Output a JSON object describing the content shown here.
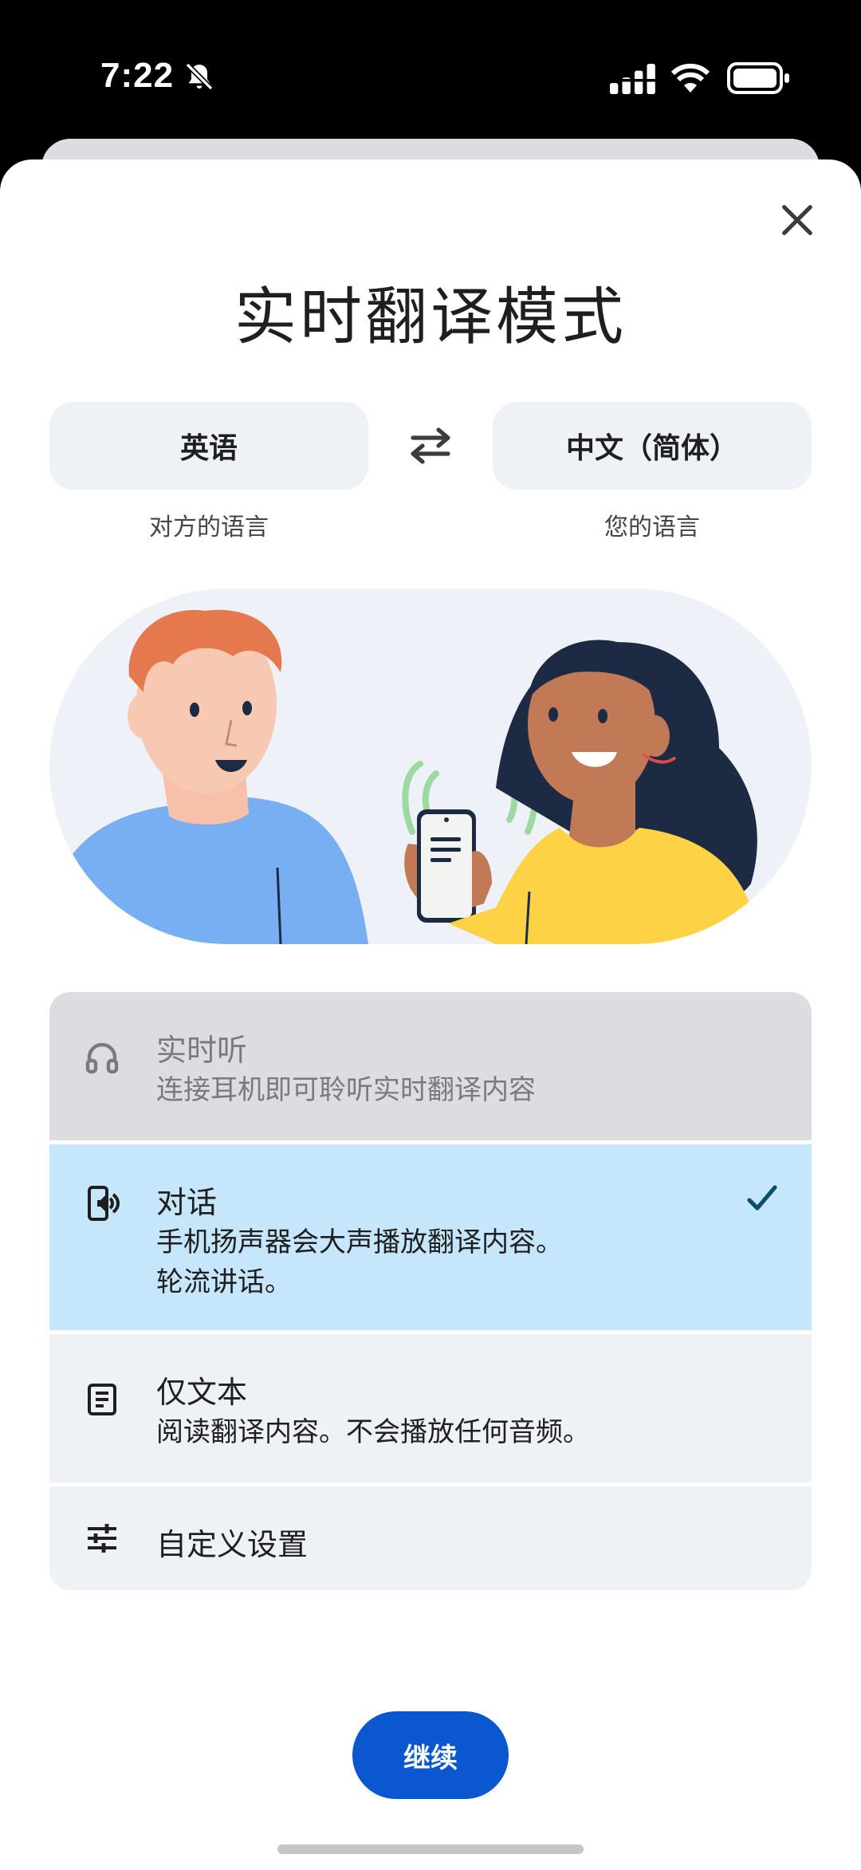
{
  "status": {
    "time": "7:22"
  },
  "title": "实时翻译模式",
  "languages": {
    "left": {
      "label": "英语",
      "caption": "对方的语言"
    },
    "right": {
      "label": "中文（简体）",
      "caption": "您的语言"
    }
  },
  "modes": [
    {
      "title": "实时听",
      "desc": "连接耳机即可聆听实时翻译内容",
      "icon": "headphones-icon",
      "state": "disabled"
    },
    {
      "title": "对话",
      "desc_line1": "手机扬声器会大声播放翻译内容。",
      "desc_line2": "轮流讲话。",
      "icon": "phone-speaker-icon",
      "state": "selected"
    },
    {
      "title": "仅文本",
      "desc": "阅读翻译内容。不会播放任何音频。",
      "icon": "document-icon"
    },
    {
      "title": "自定义设置",
      "icon": "sliders-icon"
    }
  ],
  "continue_label": "继续",
  "colors": {
    "accent": "#0b57d0",
    "selected_bg": "#c5e6fb",
    "disabled_bg": "#dcdde1",
    "option_bg": "#eef1f6"
  }
}
